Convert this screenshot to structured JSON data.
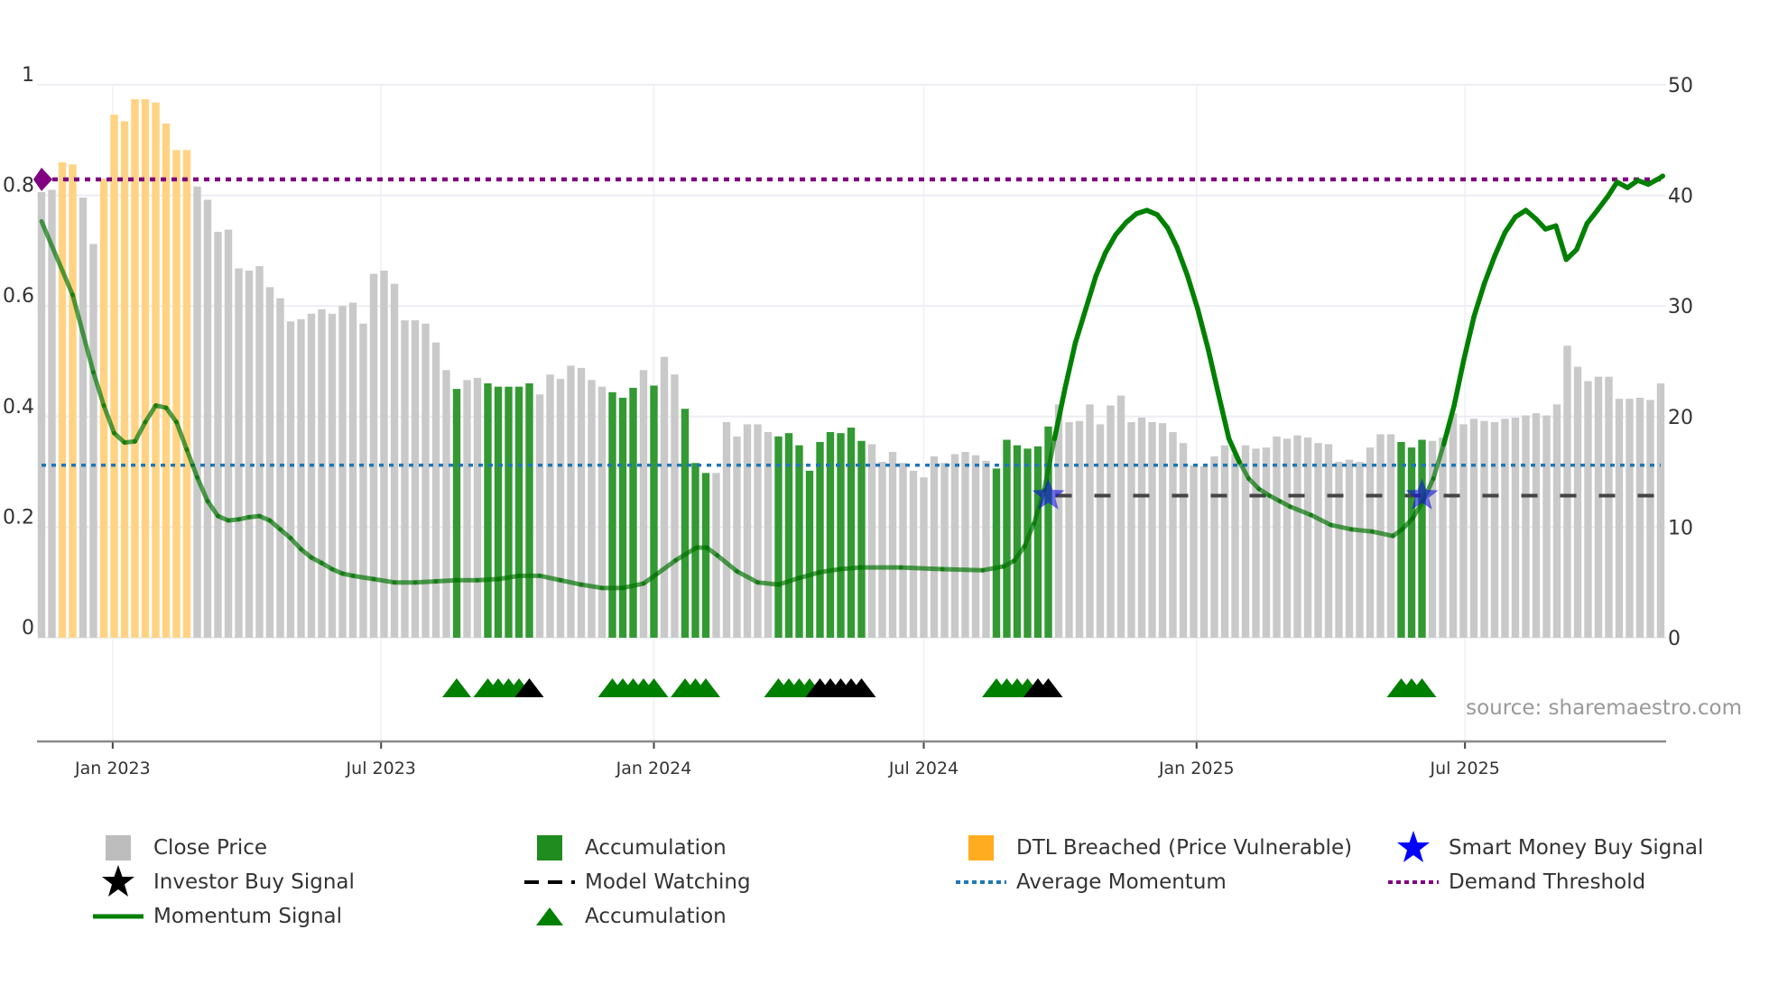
{
  "chart_data": {
    "type": "bar",
    "x_start": "2022-11-14",
    "x_interval_days": 7,
    "left_axis": {
      "ylim": [
        0,
        1
      ],
      "ticks": [
        "0",
        "0.2",
        "0.4",
        "0.6",
        "0.8",
        "1"
      ]
    },
    "right_axis": {
      "ylim": [
        0,
        50
      ],
      "ticks": [
        "0",
        "10",
        "20",
        "30",
        "40",
        "50"
      ]
    },
    "x_ticks": [
      {
        "label": "Jan 2023",
        "date": "2023-01-01"
      },
      {
        "label": "Jul 2023",
        "date": "2023-07-01"
      },
      {
        "label": "Jan 2024",
        "date": "2024-01-01"
      },
      {
        "label": "Jul 2024",
        "date": "2024-07-01"
      },
      {
        "label": "Jan 2025",
        "date": "2025-01-01"
      },
      {
        "label": "Jul 2025",
        "date": "2025-07-01"
      }
    ],
    "close_price": [
      40.3,
      40.5,
      43,
      42.8,
      39.8,
      35.6,
      41.5,
      47.3,
      46.7,
      48.7,
      48.7,
      48.4,
      46.5,
      44.1,
      44.1,
      40.8,
      39.6,
      36.7,
      36.9,
      33.4,
      33.2,
      33.6,
      31.7,
      30.7,
      28.6,
      28.8,
      29.3,
      29.7,
      29.3,
      30,
      30.3,
      28.4,
      32.9,
      33.2,
      32,
      28.7,
      28.7,
      28.4,
      26.7,
      24.2,
      22.5,
      23.3,
      23.5,
      23,
      22.7,
      22.7,
      22.7,
      23,
      22,
      23.8,
      23.4,
      24.6,
      24.4,
      23.3,
      22.7,
      22.2,
      21.7,
      22.6,
      24.2,
      22.8,
      25.4,
      23.8,
      20.7,
      15.8,
      14.9,
      14.9,
      19.5,
      18.2,
      19.3,
      19.3,
      18.6,
      18.2,
      18.5,
      17.4,
      15.1,
      17.7,
      18.6,
      18.5,
      19,
      17.8,
      17.5,
      15.9,
      16.8,
      15.8,
      15.1,
      14.5,
      16.4,
      15.8,
      16.6,
      16.8,
      16.5,
      16,
      15.3,
      17.9,
      17.4,
      17.1,
      17.3,
      19.1,
      21.1,
      19.5,
      19.6,
      21.1,
      19.3,
      21,
      21.9,
      19.5,
      19.9,
      19.5,
      19.4,
      18.6,
      17.6,
      15.6,
      15.5,
      16.4,
      17.4,
      16.6,
      17.4,
      17.1,
      17.2,
      18.2,
      18,
      18.3,
      18.1,
      17.6,
      17.5,
      15.9,
      16.1,
      15.9,
      17.2,
      18.4,
      18.4,
      17.7,
      17.2,
      17.9,
      17.8,
      18.1,
      20.3,
      19.3,
      19.8,
      19.6,
      19.5,
      19.8,
      19.9,
      20.1,
      20.3,
      20.1,
      21.1,
      26.4,
      24.5,
      23.2,
      23.6,
      23.6,
      21.6,
      21.6,
      21.7,
      21.5,
      23
    ],
    "dtl_breached_weeks": [
      2,
      3,
      6,
      7,
      8,
      9,
      10,
      11,
      12,
      13,
      14
    ],
    "accumulation_weeks": [
      40,
      43,
      44,
      45,
      46,
      47,
      55,
      56,
      57,
      59,
      62,
      63,
      64,
      71,
      72,
      73,
      74,
      75,
      76,
      77,
      78,
      79,
      92,
      93,
      94,
      95,
      96,
      97,
      131,
      132,
      133
    ],
    "momentum_signal": [
      [
        0,
        0.753
      ],
      [
        3,
        0.62
      ],
      [
        5,
        0.48
      ],
      [
        6,
        0.42
      ],
      [
        7,
        0.37
      ],
      [
        8,
        0.353
      ],
      [
        9,
        0.355
      ],
      [
        10,
        0.39
      ],
      [
        11,
        0.42
      ],
      [
        12,
        0.416
      ],
      [
        13,
        0.39
      ],
      [
        14,
        0.34
      ],
      [
        15,
        0.29
      ],
      [
        16,
        0.247
      ],
      [
        17,
        0.22
      ],
      [
        18,
        0.212
      ],
      [
        19,
        0.214
      ],
      [
        20,
        0.218
      ],
      [
        21,
        0.22
      ],
      [
        22,
        0.212
      ],
      [
        23,
        0.196
      ],
      [
        24,
        0.18
      ],
      [
        25,
        0.16
      ],
      [
        26,
        0.145
      ],
      [
        27,
        0.135
      ],
      [
        28,
        0.124
      ],
      [
        29,
        0.116
      ],
      [
        30,
        0.112
      ],
      [
        32,
        0.106
      ],
      [
        34,
        0.1
      ],
      [
        36,
        0.1
      ],
      [
        38,
        0.102
      ],
      [
        40,
        0.104
      ],
      [
        42,
        0.104
      ],
      [
        44,
        0.106
      ],
      [
        46,
        0.112
      ],
      [
        48,
        0.112
      ],
      [
        50,
        0.104
      ],
      [
        52,
        0.096
      ],
      [
        54,
        0.09
      ],
      [
        56,
        0.09
      ],
      [
        58,
        0.098
      ],
      [
        59.2,
        0.114
      ],
      [
        61.1,
        0.14
      ],
      [
        63.1,
        0.163
      ],
      [
        64.1,
        0.163
      ],
      [
        65.1,
        0.149
      ],
      [
        67,
        0.12
      ],
      [
        69,
        0.1
      ],
      [
        71,
        0.096
      ],
      [
        73,
        0.108
      ],
      [
        74.9,
        0.118
      ],
      [
        76.9,
        0.124
      ],
      [
        78.9,
        0.127
      ],
      [
        82.8,
        0.127
      ],
      [
        86.8,
        0.124
      ],
      [
        90.7,
        0.122
      ],
      [
        92.7,
        0.129
      ],
      [
        93.7,
        0.139
      ],
      [
        94.7,
        0.165
      ],
      [
        95.6,
        0.206
      ],
      [
        96.6,
        0.267
      ],
      [
        97.6,
        0.36
      ],
      [
        98.6,
        0.45
      ],
      [
        99.6,
        0.533
      ],
      [
        100.6,
        0.594
      ],
      [
        101.6,
        0.655
      ],
      [
        102.5,
        0.696
      ],
      [
        103.5,
        0.729
      ],
      [
        104.5,
        0.751
      ],
      [
        105.5,
        0.767
      ],
      [
        106.5,
        0.773
      ],
      [
        107.5,
        0.765
      ],
      [
        108.5,
        0.741
      ],
      [
        109.4,
        0.706
      ],
      [
        110.4,
        0.655
      ],
      [
        111.4,
        0.594
      ],
      [
        112.4,
        0.522
      ],
      [
        113.4,
        0.44
      ],
      [
        114.4,
        0.36
      ],
      [
        115.4,
        0.318
      ],
      [
        116.3,
        0.288
      ],
      [
        117.3,
        0.269
      ],
      [
        118.3,
        0.257
      ],
      [
        119.3,
        0.247
      ],
      [
        120.3,
        0.237
      ],
      [
        122.3,
        0.222
      ],
      [
        124.2,
        0.204
      ],
      [
        126.2,
        0.196
      ],
      [
        128.2,
        0.192
      ],
      [
        130.2,
        0.184
      ],
      [
        131.1,
        0.196
      ],
      [
        132.1,
        0.216
      ],
      [
        133.1,
        0.247
      ],
      [
        134.1,
        0.288
      ],
      [
        135.1,
        0.35
      ],
      [
        136.1,
        0.42
      ],
      [
        137,
        0.5
      ],
      [
        138,
        0.58
      ],
      [
        139,
        0.64
      ],
      [
        140,
        0.69
      ],
      [
        141,
        0.733
      ],
      [
        142,
        0.761
      ],
      [
        143,
        0.773
      ],
      [
        144,
        0.757
      ],
      [
        144.9,
        0.739
      ],
      [
        145.9,
        0.745
      ],
      [
        146.9,
        0.684
      ],
      [
        147.9,
        0.702
      ],
      [
        148.9,
        0.749
      ],
      [
        149.9,
        0.773
      ],
      [
        150.9,
        0.798
      ],
      [
        151.8,
        0.824
      ],
      [
        152.8,
        0.814
      ],
      [
        153.8,
        0.827
      ],
      [
        154.8,
        0.82
      ],
      [
        155.8,
        0.83
      ],
      [
        156.2,
        0.835
      ]
    ],
    "average_momentum": 0.312,
    "demand_threshold": 0.829,
    "model_watching": {
      "level": 0.257,
      "from_week": 97,
      "to_week": 156
    },
    "smart_money_buy_signals": [
      {
        "week": 97,
        "value": 0.257
      },
      {
        "week": 133,
        "value": 0.257
      }
    ],
    "accumulation_triangles": [
      40,
      43,
      44,
      45,
      46,
      55,
      56,
      57,
      58,
      59,
      62,
      63,
      64,
      71,
      72,
      73,
      74,
      92,
      93,
      94,
      95,
      131,
      132,
      133
    ],
    "black_triangles": [
      47,
      75,
      76,
      77,
      78,
      79,
      96,
      97
    ],
    "colors": {
      "close": "#c9c9c9",
      "accumulation": "#339933",
      "dtl": "#ffd383",
      "momentum": "#008000",
      "average": "#1f77b4",
      "threshold": "#800080",
      "watching": "#444444",
      "smart_money": "#1010e0",
      "investor": "#000000"
    },
    "source": "source: sharemaestro.com",
    "legend": [
      {
        "label": "Close Price",
        "symbol": "gray-square"
      },
      {
        "label": "Accumulation",
        "symbol": "green-square"
      },
      {
        "label": "DTL Breached (Price Vulnerable)",
        "symbol": "orange-square"
      },
      {
        "label": "Smart Money Buy Signal",
        "symbol": "blue-star"
      },
      {
        "label": "Investor Buy Signal",
        "symbol": "black-star"
      },
      {
        "label": "Model Watching",
        "symbol": "black-dash"
      },
      {
        "label": "Average Momentum",
        "symbol": "blue-dot"
      },
      {
        "label": "Demand Threshold",
        "symbol": "purple-dot"
      },
      {
        "label": "Momentum Signal",
        "symbol": "green-line"
      },
      {
        "label": "Accumulation",
        "symbol": "green-triangle"
      }
    ]
  }
}
